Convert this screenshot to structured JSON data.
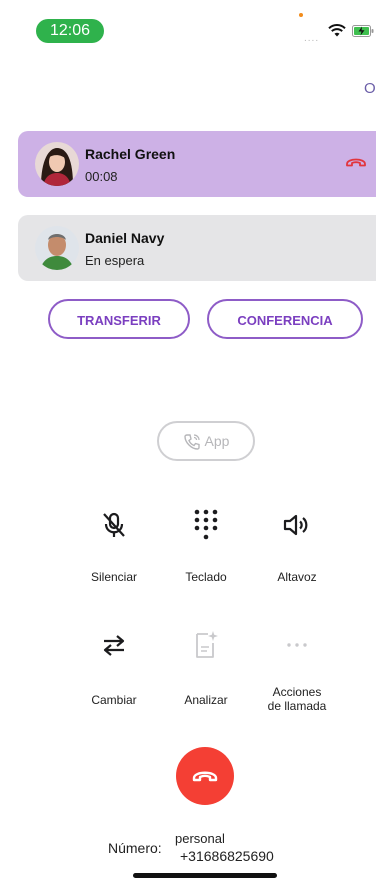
{
  "status_bar": {
    "time": "12:06",
    "signal": "....",
    "icons": [
      "wifi-icon",
      "battery-charging-icon"
    ],
    "accent": "#2fb24c"
  },
  "header": {
    "right_glyph": "O"
  },
  "calls": [
    {
      "name": "Rachel Green",
      "status": "00:08",
      "state": "active",
      "background": "#cdb1e6"
    },
    {
      "name": "Daniel Navy",
      "status": "En espera",
      "state": "hold",
      "background": "#e5e5e7"
    }
  ],
  "actions": {
    "transfer": "TRANSFERIR",
    "conference": "CONFERENCIA",
    "color": "#7b3fc0"
  },
  "app_button": {
    "label": "App"
  },
  "controls": [
    {
      "label": "Silenciar",
      "icon": "mic-muted-icon"
    },
    {
      "label": "Teclado",
      "icon": "keypad-icon"
    },
    {
      "label": "Altavoz",
      "icon": "speaker-icon"
    },
    {
      "label": "Cambiar",
      "icon": "swap-icon"
    },
    {
      "label": "Analizar",
      "icon": "analyze-document-icon"
    },
    {
      "label_line1": "Acciones",
      "label_line2": "de llamada",
      "icon": "more-icon"
    }
  ],
  "end_call": {
    "color": "#f43f34",
    "icon": "hangup-icon"
  },
  "footer": {
    "number_label": "Número:",
    "number_type": "personal",
    "number": "+31686825690"
  }
}
